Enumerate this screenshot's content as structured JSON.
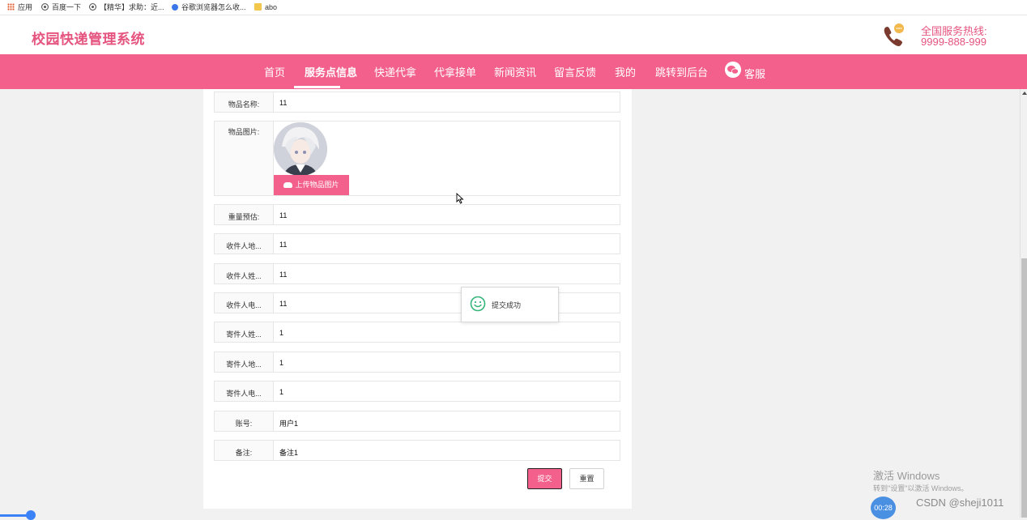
{
  "bookmarks": [
    {
      "label": "应用",
      "icon": "apps-grid-icon"
    },
    {
      "label": "百度一下",
      "icon": "globe-icon"
    },
    {
      "label": "【精华】求助：近...",
      "icon": "globe-icon"
    },
    {
      "label": "谷歌浏览器怎么收...",
      "icon": "paw-icon"
    },
    {
      "label": "abo",
      "icon": "folder-icon"
    }
  ],
  "header": {
    "title": "校园快递管理系统",
    "hotline_label": "全国服务热线:",
    "hotline_number": "9999-888-999",
    "phone_icon": "phone-icon"
  },
  "nav": {
    "items": [
      "首页",
      "服务点信息",
      "快递代拿",
      "代拿接单",
      "新闻资讯",
      "留言反馈",
      "我的",
      "跳转到后台",
      "客服"
    ],
    "active_index": 1,
    "chat_icon": "wechat-icon"
  },
  "form": {
    "fields": [
      {
        "label": "物品名称:",
        "value": "11"
      },
      {
        "label": "物品图片:",
        "value": ""
      },
      {
        "label": "重量预估:",
        "value": "11"
      },
      {
        "label": "收件人地...",
        "value": "11"
      },
      {
        "label": "收件人姓...",
        "value": "11"
      },
      {
        "label": "收件人电...",
        "value": "11"
      },
      {
        "label": "寄件人姓...",
        "value": "1"
      },
      {
        "label": "寄件人地...",
        "value": "1"
      },
      {
        "label": "寄件人电...",
        "value": "1"
      },
      {
        "label": "账号:",
        "value": "用户1"
      },
      {
        "label": "备注:",
        "value": "备注1"
      }
    ],
    "upload_label": "上传物品图片",
    "upload_icon": "cloud-upload-icon",
    "submit_label": "提交",
    "reset_label": "重置"
  },
  "toast": {
    "text": "提交成功",
    "icon": "smile-icon"
  },
  "overlay": {
    "windows_activate_title": "激活 Windows",
    "windows_activate_sub": "转到\"设置\"以激活 Windows。",
    "csdn_watermark": "CSDN @sheji1011",
    "timer": "00:28"
  },
  "colors": {
    "brand_pink": "#f3608c",
    "title_pink": "#e5547f",
    "phone_brown": "#7a3b2e",
    "toast_green": "#34b67a"
  }
}
